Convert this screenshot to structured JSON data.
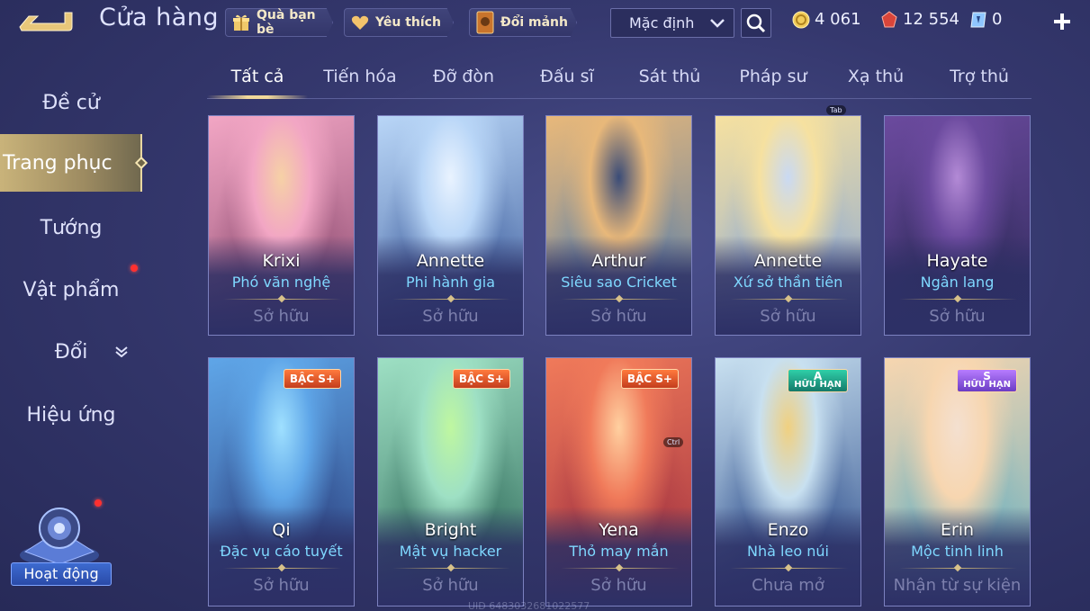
{
  "header": {
    "title": "Cửa hàng",
    "buttons": [
      {
        "label": "Quà bạn bè",
        "icon": "gift-icon"
      },
      {
        "label": "Yêu thích",
        "icon": "heart-icon"
      },
      {
        "label": "Đổi mảnh",
        "icon": "shard-card-icon"
      }
    ],
    "sort_value": "Mặc định",
    "currencies": [
      {
        "icon": "gold-coin-icon",
        "value": "4 061"
      },
      {
        "icon": "red-gem-icon",
        "value": "12 554"
      },
      {
        "icon": "ticket-icon",
        "value": "0"
      }
    ]
  },
  "sidebar": {
    "items": [
      {
        "label": "Đề cử"
      },
      {
        "label": "Trang phục"
      },
      {
        "label": "Tướng"
      },
      {
        "label": "Vật phẩm"
      },
      {
        "label": "Đổi"
      },
      {
        "label": "Hiệu ứng"
      }
    ],
    "activity_label": "Hoạt động"
  },
  "tabs": [
    "Tất cả",
    "Tiến hóa",
    "Đỡ đòn",
    "Đấu sĩ",
    "Sát thủ",
    "Pháp sư",
    "Xạ thủ",
    "Trợ thủ"
  ],
  "tip_labels": {
    "tab": "Tab",
    "ctrl": "Ctrl"
  },
  "cards": [
    {
      "hero": "Krixi",
      "skin": "Phó văn nghệ",
      "status": "Sở hữu",
      "badge": null
    },
    {
      "hero": "Annette",
      "skin": "Phi hành gia",
      "status": "Sở hữu",
      "badge": null
    },
    {
      "hero": "Arthur",
      "skin": "Siêu sao Cricket",
      "status": "Sở hữu",
      "badge": null
    },
    {
      "hero": "Annette",
      "skin": "Xứ sở thần tiên",
      "status": "Sở hữu",
      "badge": null
    },
    {
      "hero": "Hayate",
      "skin": "Ngân lang",
      "status": "Sở hữu",
      "badge": null
    },
    {
      "hero": "Qi",
      "skin": "Đặc vụ cáo tuyết",
      "status": "Sở hữu",
      "badge": {
        "type": "splus",
        "text": "BẬC S+"
      }
    },
    {
      "hero": "Bright",
      "skin": "Mật vụ hacker",
      "status": "Sở hữu",
      "badge": {
        "type": "splus",
        "text": "BẬC S+"
      }
    },
    {
      "hero": "Yena",
      "skin": "Thỏ may mắn",
      "status": "Sở hữu",
      "badge": {
        "type": "splus",
        "text": "BẬC S+"
      }
    },
    {
      "hero": "Enzo",
      "skin": "Nhà leo núi",
      "status": "Chưa mở",
      "badge": {
        "type": "a",
        "text": "A",
        "sub": "HỮU HẠN"
      }
    },
    {
      "hero": "Erin",
      "skin": "Mộc tinh linh",
      "status": "Nhận từ sự kiện",
      "badge": {
        "type": "s",
        "text": "S",
        "sub": "HỮU HẠN"
      }
    }
  ],
  "uid_text": "UID 6483032681022577",
  "colors": {
    "accent_gold": "#f1d89a",
    "skin_name": "#7fd8ff",
    "background": "#35386e"
  }
}
